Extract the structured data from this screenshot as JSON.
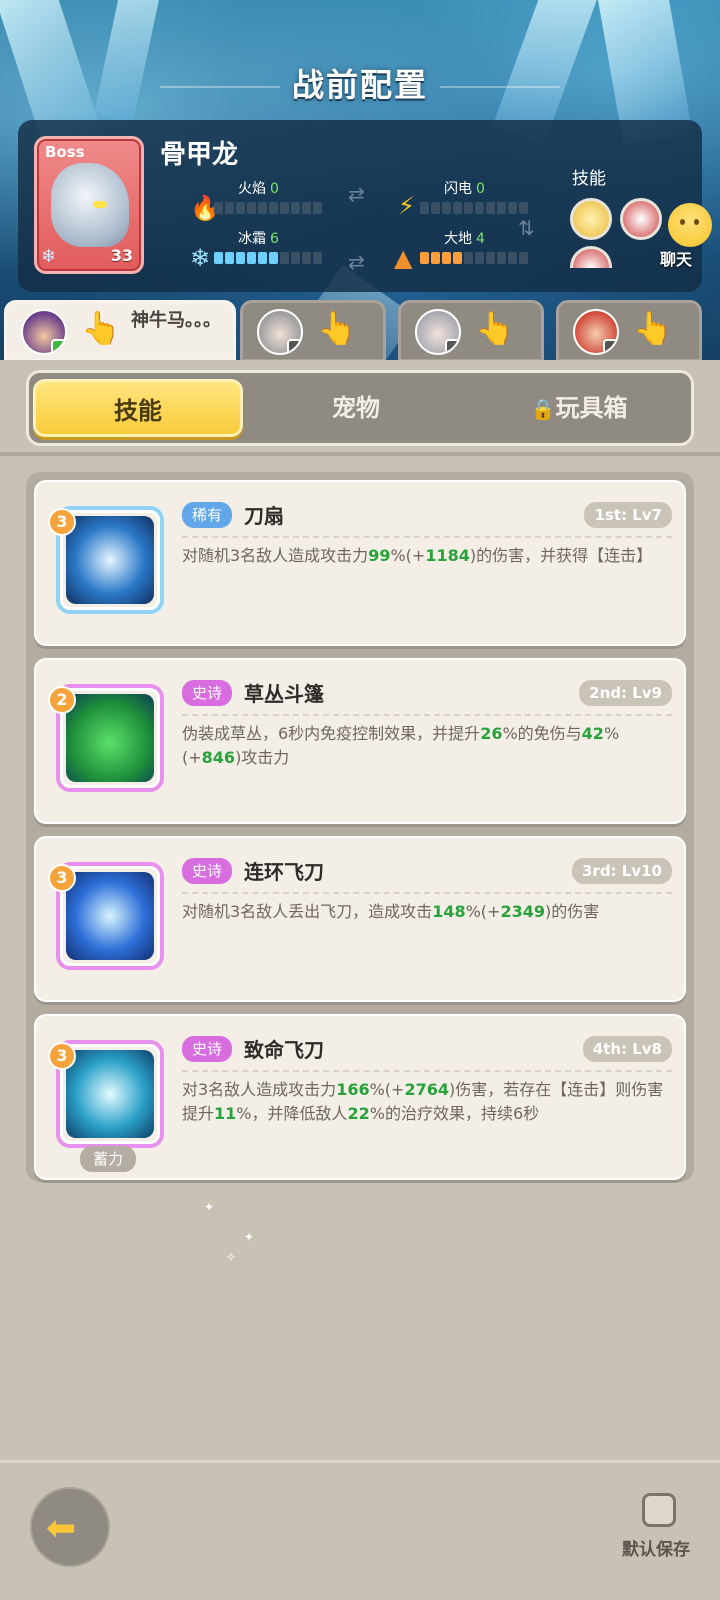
{
  "page_title": "战前配置",
  "boss": {
    "tag": "Boss",
    "name": "骨甲龙",
    "level": "33",
    "elements": [
      {
        "label": "火焰",
        "value": "0",
        "fill": 0
      },
      {
        "label": "闪电",
        "value": "0",
        "fill": 0
      },
      {
        "label": "冰霜",
        "value": "6",
        "fill": 6
      },
      {
        "label": "大地",
        "value": "4",
        "fill": 4
      }
    ],
    "skills_label": "技能"
  },
  "chat_label": "聊天",
  "heroes": [
    {
      "name": "神牛马。。。",
      "active": true
    },
    {
      "name": "",
      "active": false
    },
    {
      "name": "",
      "active": false
    },
    {
      "name": "",
      "active": false
    }
  ],
  "segments": {
    "skills": "技能",
    "pets": "宠物",
    "toybox": "玩具箱"
  },
  "skills": [
    {
      "rarity": "稀有",
      "name": "刀扇",
      "order": "1st: Lv7",
      "count": "3",
      "desc": [
        "对随机3名敌人造成攻击力",
        "99",
        "%(+",
        "1184",
        ")的伤害，并获得【连击】"
      ]
    },
    {
      "rarity": "史诗",
      "name": "草丛斗篷",
      "order": "2nd: Lv9",
      "count": "2",
      "desc": [
        "伪装成草丛，6秒内免疫控制效果，并提升",
        "26",
        "%的免伤与",
        "42",
        "%(+",
        "846",
        ")攻击力"
      ]
    },
    {
      "rarity": "史诗",
      "name": "连环飞刀",
      "order": "3rd: Lv10",
      "count": "3",
      "desc": [
        "对随机3名敌人丢出飞刀，造成攻击",
        "148",
        "%(+",
        "2349",
        ")的伤害"
      ]
    },
    {
      "rarity": "史诗",
      "name": "致命飞刀",
      "order": "4th: Lv8",
      "count": "3",
      "charge": "蓄力",
      "desc": [
        "对3名敌人造成攻击力",
        "166",
        "%(+",
        "2764",
        ")伤害，若存在【连击】则伤害提升",
        "11",
        "%，并降低敌人",
        "22",
        "%的治疗效果，持续6秒"
      ]
    }
  ],
  "bottom": {
    "save_label": "默认保存"
  },
  "colors": {
    "rare": "#62a7e9",
    "epic": "#d86de0",
    "highlight": "#28a23b",
    "active_tab": "#f8cc3a"
  }
}
